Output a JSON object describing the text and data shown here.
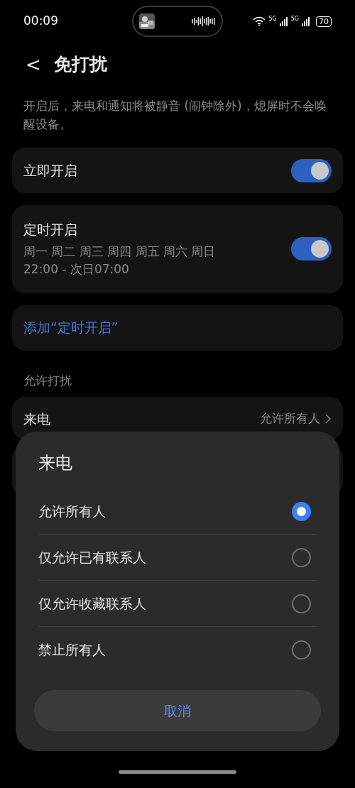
{
  "status_bar": {
    "time": "00:09",
    "network_1": "5G",
    "network_2": "5G",
    "battery": "70"
  },
  "header": {
    "back": "<",
    "title": "免打扰"
  },
  "description": "开启后，来电和通知将被静音 (闹钟除外)，熄屏时不会唤醒设备。",
  "toggles": [
    {
      "title": "立即开启",
      "on": true
    },
    {
      "title": "定时开启",
      "days": "周一 周二 周三 周四 周五 周六 周日",
      "time": "22:00 - 次日07:00",
      "on": true
    }
  ],
  "add_link": "添加“定时开启”",
  "section_label": "允许打扰",
  "calls_row": {
    "label": "来电",
    "value": "允许所有人"
  },
  "sheet": {
    "title": "来电",
    "options": [
      {
        "label": "允许所有人",
        "selected": true
      },
      {
        "label": "仅允许已有联系人",
        "selected": false
      },
      {
        "label": "仅允许收藏联系人",
        "selected": false
      },
      {
        "label": "禁止所有人",
        "selected": false
      }
    ],
    "cancel": "取消"
  }
}
